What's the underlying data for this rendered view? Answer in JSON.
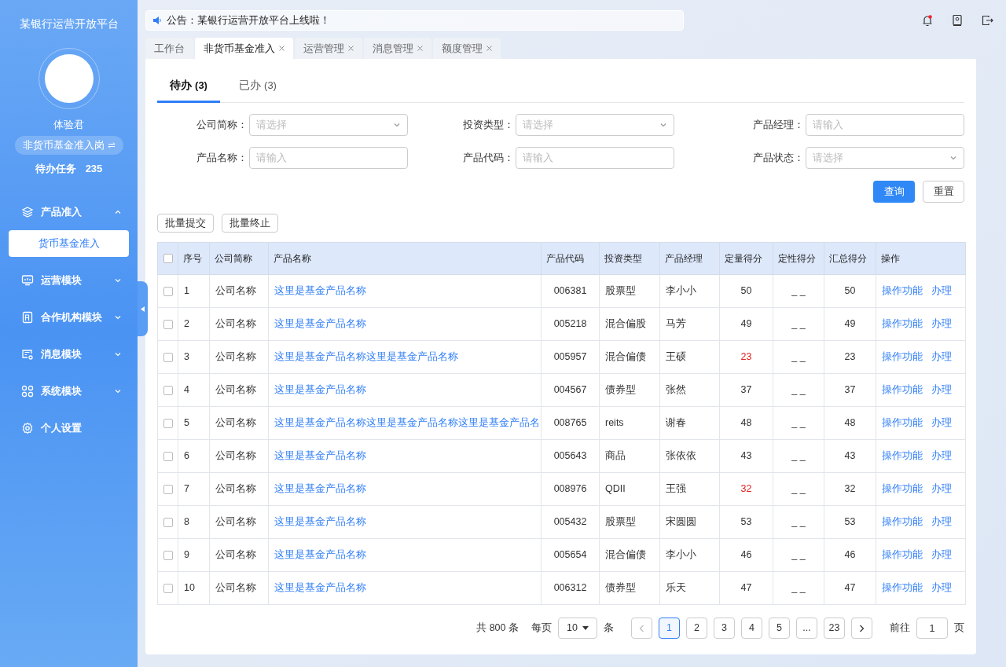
{
  "sidebar": {
    "title": "某银行运营开放平台",
    "user": "体验君",
    "role": "非货币基金准入岗",
    "todo_label": "待办任务",
    "todo_count": "235",
    "menu": [
      {
        "label": "产品准入",
        "kind": "layers",
        "expanded": true,
        "children": [
          {
            "label": "货币基金准入",
            "selected": true
          }
        ]
      },
      {
        "label": "运营模块",
        "kind": "monitor",
        "expanded": false
      },
      {
        "label": "合作机构模块",
        "kind": "building",
        "expanded": false
      },
      {
        "label": "消息模块",
        "kind": "message",
        "expanded": false
      },
      {
        "label": "系统模块",
        "kind": "grid",
        "expanded": false
      },
      {
        "label": "个人设置",
        "kind": "gear"
      }
    ]
  },
  "notice": "公告：某银行运营开放平台上线啦！",
  "header": {
    "has_unread": true
  },
  "tabs": [
    {
      "label": "工作台",
      "selected": false,
      "closable": false
    },
    {
      "label": "非货币基金准入",
      "selected": true,
      "closable": true
    },
    {
      "label": "运营管理",
      "selected": false,
      "closable": true
    },
    {
      "label": "消息管理",
      "selected": false,
      "closable": true
    },
    {
      "label": "额度管理",
      "selected": false,
      "closable": true
    }
  ],
  "subtabs": [
    {
      "label": "待办",
      "count": "(3)",
      "selected": true
    },
    {
      "label": "已办",
      "count": "(3)",
      "selected": false
    }
  ],
  "filters": [
    {
      "label": "公司简称：",
      "placeholder": "请选择",
      "kind": "select"
    },
    {
      "label": "投资类型：",
      "placeholder": "请选择",
      "kind": "select"
    },
    {
      "label": "产品经理：",
      "placeholder": "请输入",
      "kind": "input"
    },
    {
      "label": "产品名称：",
      "placeholder": "请输入",
      "kind": "input"
    },
    {
      "label": "产品代码：",
      "placeholder": "请输入",
      "kind": "input"
    },
    {
      "label": "产品状态：",
      "placeholder": "请选择",
      "kind": "select"
    }
  ],
  "query_button": "查询",
  "reset_button": "重置",
  "batch_buttons": [
    "批量提交",
    "批量终止"
  ],
  "table": {
    "all_checked": false,
    "columns": [
      "序号",
      "公司简称",
      "产品名称",
      "产品代码",
      "投资类型",
      "产品经理",
      "定量得分",
      "定性得分",
      "汇总得分",
      "操作"
    ],
    "rows": [
      {
        "checked": false,
        "no": "1",
        "company": "公司名称",
        "name": "这里是基金产品名称",
        "code": "006381",
        "type": "股票型",
        "manager": "李小小",
        "quant": "50",
        "warn": false,
        "qual": "_ _",
        "total": "50",
        "actions": [
          "操作功能",
          "办理"
        ]
      },
      {
        "checked": false,
        "no": "2",
        "company": "公司名称",
        "name": "这里是基金产品名称",
        "code": "005218",
        "type": "混合偏股",
        "manager": "马芳",
        "quant": "49",
        "warn": false,
        "qual": "_ _",
        "total": "49",
        "actions": [
          "操作功能",
          "办理"
        ]
      },
      {
        "checked": false,
        "no": "3",
        "company": "公司名称",
        "name": "这里是基金产品名称这里是基金产品名称",
        "code": "005957",
        "type": "混合偏债",
        "manager": "王硕",
        "quant": "23",
        "warn": true,
        "qual": "_ _",
        "total": "23",
        "actions": [
          "操作功能",
          "办理"
        ]
      },
      {
        "checked": false,
        "no": "4",
        "company": "公司名称",
        "name": "这里是基金产品名称",
        "code": "004567",
        "type": "债券型",
        "manager": "张然",
        "quant": "37",
        "warn": false,
        "qual": "_ _",
        "total": "37",
        "actions": [
          "操作功能",
          "办理"
        ]
      },
      {
        "checked": false,
        "no": "5",
        "company": "公司名称",
        "name": "这里是基金产品名称这里是基金产品名称这里是基金产品名",
        "code": "008765",
        "type": "reits",
        "manager": "谢春",
        "quant": "48",
        "warn": false,
        "qual": "_ _",
        "total": "48",
        "actions": [
          "操作功能",
          "办理"
        ]
      },
      {
        "checked": false,
        "no": "6",
        "company": "公司名称",
        "name": "这里是基金产品名称",
        "code": "005643",
        "type": "商品",
        "manager": "张依依",
        "quant": "43",
        "warn": false,
        "qual": "_ _",
        "total": "43",
        "actions": [
          "操作功能",
          "办理"
        ]
      },
      {
        "checked": false,
        "no": "7",
        "company": "公司名称",
        "name": "这里是基金产品名称",
        "code": "008976",
        "type": "QDII",
        "manager": "王强",
        "quant": "32",
        "warn": true,
        "qual": "_ _",
        "total": "32",
        "actions": [
          "操作功能",
          "办理"
        ]
      },
      {
        "checked": false,
        "no": "8",
        "company": "公司名称",
        "name": "这里是基金产品名称",
        "code": "005432",
        "type": "股票型",
        "manager": "宋圆圆",
        "quant": "53",
        "warn": false,
        "qual": "_ _",
        "total": "53",
        "actions": [
          "操作功能",
          "办理"
        ]
      },
      {
        "checked": false,
        "no": "9",
        "company": "公司名称",
        "name": "这里是基金产品名称",
        "code": "005654",
        "type": "混合偏债",
        "manager": "李小小",
        "quant": "46",
        "warn": false,
        "qual": "_ _",
        "total": "46",
        "actions": [
          "操作功能",
          "办理"
        ]
      },
      {
        "checked": false,
        "no": "10",
        "company": "公司名称",
        "name": "这里是基金产品名称",
        "code": "006312",
        "type": "债券型",
        "manager": "乐天",
        "quant": "47",
        "warn": false,
        "qual": "_ _",
        "total": "47",
        "actions": [
          "操作功能",
          "办理"
        ]
      }
    ]
  },
  "pagination": {
    "total": "共 800 条",
    "per_page_label": "每页",
    "per_page": "10",
    "per_page_unit": "条",
    "prev_disabled": true,
    "pages": [
      {
        "label": "1",
        "selected": true
      },
      {
        "label": "2",
        "selected": false
      },
      {
        "label": "3",
        "selected": false
      },
      {
        "label": "4",
        "selected": false
      },
      {
        "label": "5",
        "selected": false
      },
      {
        "label": "...",
        "selected": false
      },
      {
        "label": "23",
        "selected": false
      }
    ],
    "goto_label": "前往",
    "goto_value": "1",
    "goto_unit": "页"
  }
}
